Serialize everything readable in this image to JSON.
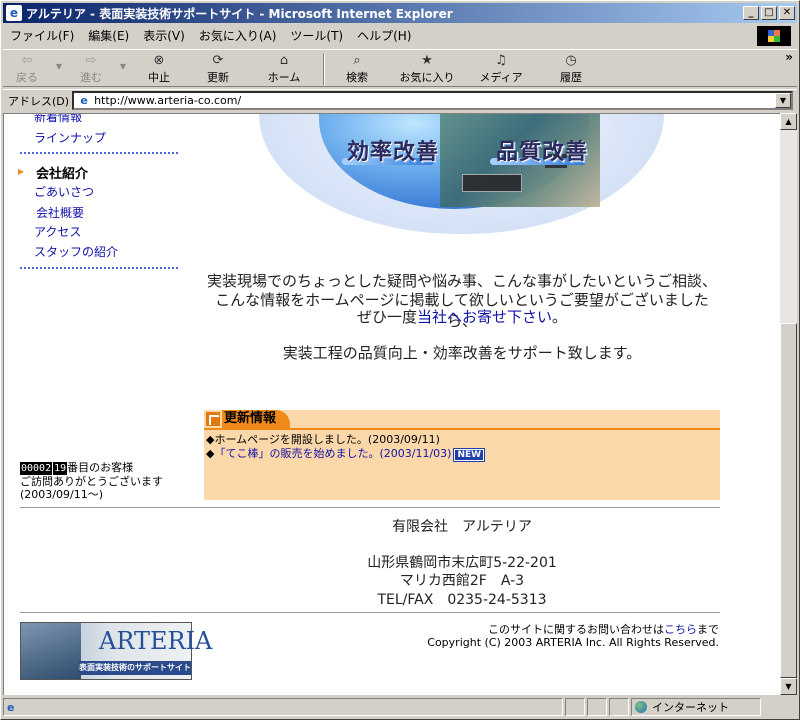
{
  "window": {
    "title": "アルテリア - 表面実装技術サポートサイト - Microsoft Internet Explorer"
  },
  "menu": [
    "ファイル(F)",
    "編集(E)",
    "表示(V)",
    "お気に入り(A)",
    "ツール(T)",
    "ヘルプ(H)"
  ],
  "toolbar": {
    "back": "戻る",
    "forward": "進む",
    "stop": "中止",
    "refresh": "更新",
    "home": "ホーム",
    "search": "検索",
    "favorites": "お気に入り",
    "media": "メディア",
    "history": "履歴"
  },
  "address": {
    "label": "アドレス(D)",
    "url": "http://www.arteria-co.com/"
  },
  "sidebar": {
    "top_items": [
      "新着情報",
      "ラインナップ"
    ],
    "section_title": "会社紹介",
    "company_items": [
      "ごあいさつ",
      "会社概要",
      "アクセス",
      "スタッフの紹介"
    ]
  },
  "hero": {
    "left_caption": "効率改善",
    "right_caption": "品質改善"
  },
  "intro": {
    "line1": "実装現場でのちょっとした疑問や悩み事、こんな事がしたいというご相談、",
    "line2": "こんな情報をホームページに掲載して欲しいというご要望がございましたら、",
    "line3_pre": "ぜひ一度",
    "line3_link": "当社へお寄せ下さい",
    "line3_post": "。",
    "line4": "実装工程の品質向上・効率改善をサポート致します。"
  },
  "news": {
    "heading": "更新情報",
    "items": [
      {
        "bullet": "◆",
        "text": "ホームページを開設しました。(2003/09/11)"
      },
      {
        "bullet": "◆",
        "pre": "「",
        "link": "てこ棒",
        "post": "」の販売を始めました。(2003/11/03)",
        "badge": "NEW"
      }
    ]
  },
  "counter": {
    "digits": "00002",
    "digits2": "19",
    "suffix": "番目のお客様",
    "line2": "ご訪問ありがとうございます",
    "line3": "(2003/09/11～)"
  },
  "company": {
    "name": "有限会社　アルテリア",
    "addr1": "山形県鶴岡市末広町5-22-201",
    "addr2": "マリカ西館2F　A-3",
    "tel": "TEL/FAX　0235-24-5313"
  },
  "footer": {
    "contact_pre": "このサイトに関するお問い合わせは",
    "contact_link": "こちら",
    "contact_post": "まで",
    "copyright": "Copyright (C) 2003 ARTERIA Inc. All Rights Reserved."
  },
  "logo": {
    "brand": "ARTERIA",
    "tagline": "表面実装技術のサポートサイト"
  },
  "status": {
    "zone": "インターネット"
  }
}
